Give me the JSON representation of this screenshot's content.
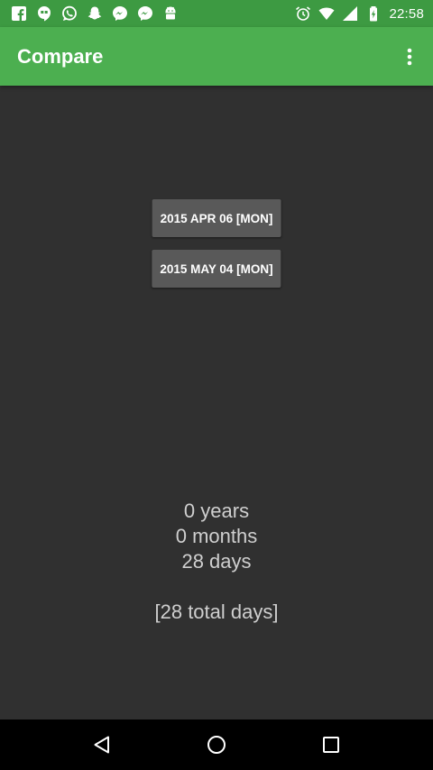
{
  "status_bar": {
    "time": "22:58",
    "left_icons": [
      "facebook-icon",
      "hangouts-icon",
      "whatsapp-icon",
      "snapchat-icon",
      "messenger-icon",
      "messenger-icon",
      "android-icon"
    ],
    "right_icons": [
      "alarm-icon",
      "wifi-icon",
      "signal-icon",
      "battery-icon"
    ],
    "color": "#3d9a42"
  },
  "app_bar": {
    "title": "Compare",
    "color": "#4caf50"
  },
  "dates": {
    "first_label": "2015 APR 06 [MON]",
    "second_label": "2015 MAY 04 [MON]"
  },
  "result": {
    "years": "0 years",
    "months": "0 months",
    "days": "28 days",
    "total": "[28 total days]"
  },
  "colors": {
    "background": "#303030",
    "button": "#595959",
    "text": "#cfcfcf"
  }
}
